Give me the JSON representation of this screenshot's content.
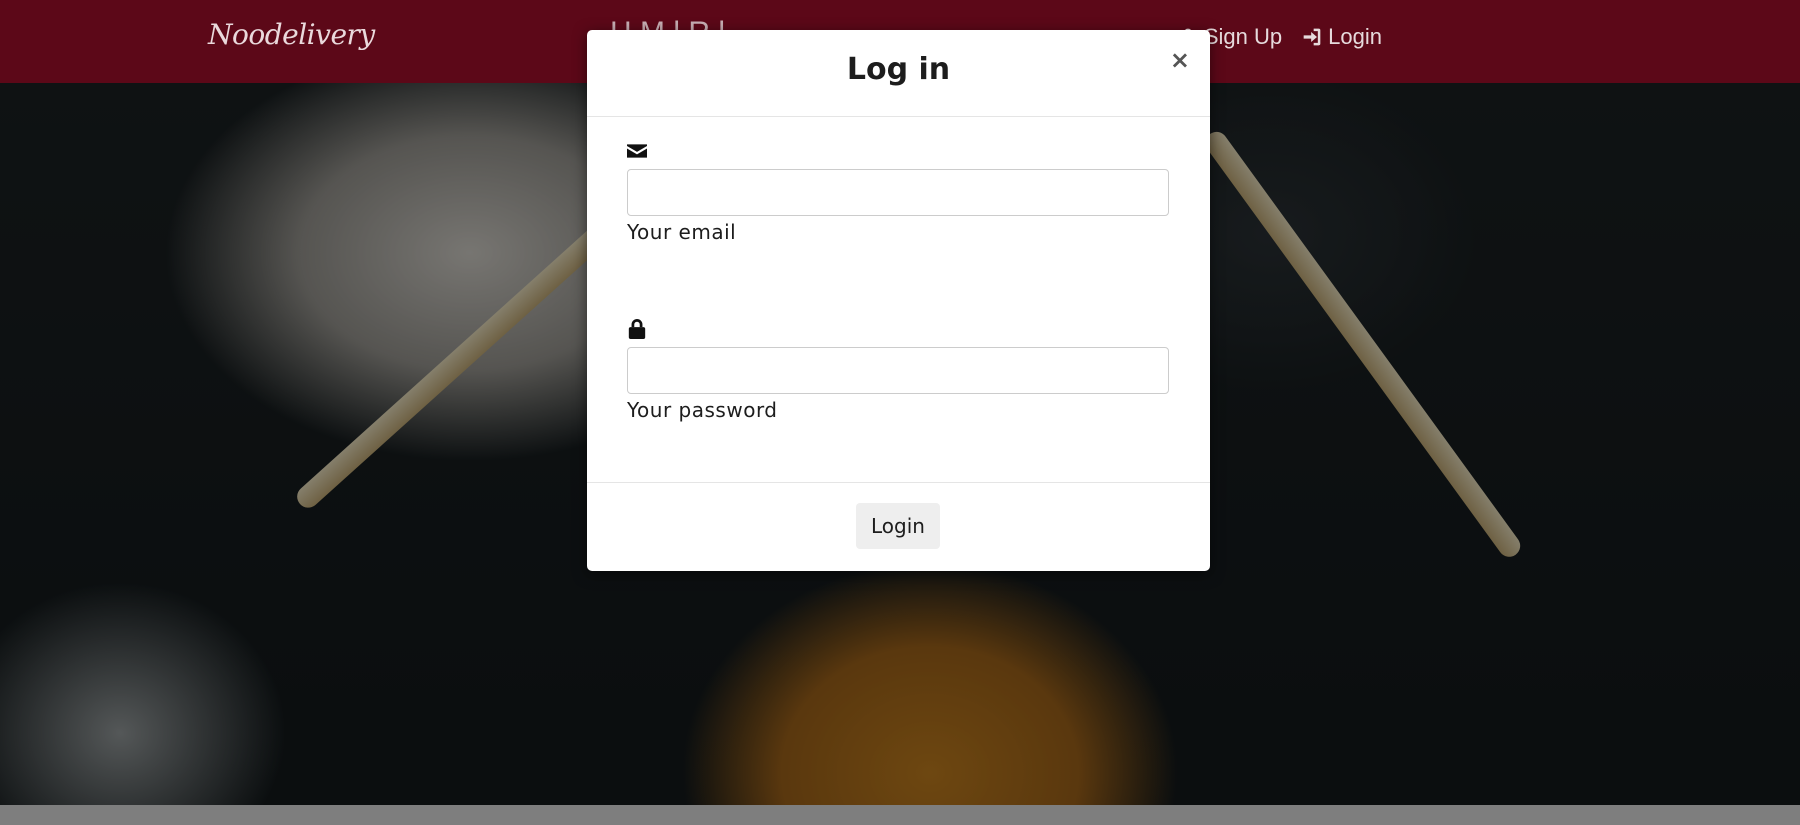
{
  "navbar": {
    "brand": "Noodelivery",
    "center_text": "H       M   l  R     l",
    "signup_label": "Sign Up",
    "login_label": "Login"
  },
  "modal": {
    "title": "Log in",
    "close_glyph": "×",
    "email": {
      "icon": "envelope-icon",
      "value": "",
      "label": "Your email"
    },
    "password": {
      "icon": "lock-icon",
      "value": "",
      "label": "Your password"
    },
    "submit_label": "Login"
  },
  "colors": {
    "navbar_bg": "#5c0818",
    "modal_bg": "#ffffff",
    "button_bg": "#eeeeee"
  }
}
